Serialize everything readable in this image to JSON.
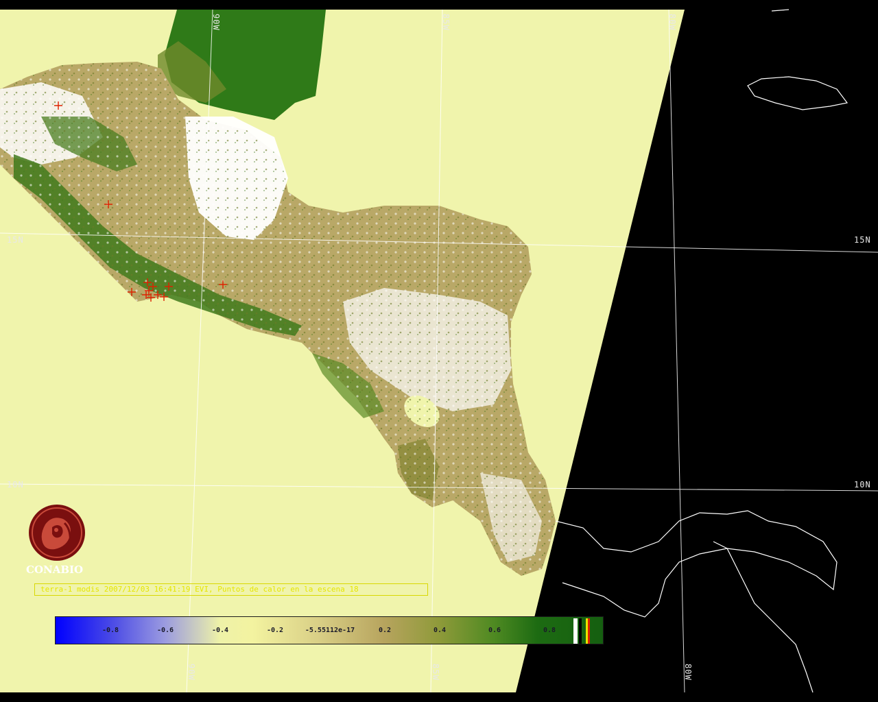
{
  "map": {
    "grid_labels": {
      "lon_top": [
        "90W",
        "85W",
        "80W"
      ],
      "lon_bottom": [
        "90W",
        "85W",
        "80W"
      ],
      "lat_left": [
        "15N",
        "10N"
      ],
      "lat_right": [
        "15N",
        "10N"
      ]
    },
    "colors": {
      "swath_background": "#f0f4ac",
      "outside_swath": "#000000",
      "coastline": "#ffffff",
      "hotspot_marker": "#dd2200"
    }
  },
  "logo": {
    "name": "CONABIO"
  },
  "caption": {
    "text": "terra-1 modis 2007/12/03 16:41:19 EVI, Puntos de calor en la escena 18"
  },
  "colorbar": {
    "ticks": [
      "-0.8",
      "-0.6",
      "-0.4",
      "-0.2",
      "-5.55112e-17",
      "0.2",
      "0.4",
      "0.6",
      "0.8"
    ],
    "range": [
      -1.0,
      1.0
    ]
  }
}
